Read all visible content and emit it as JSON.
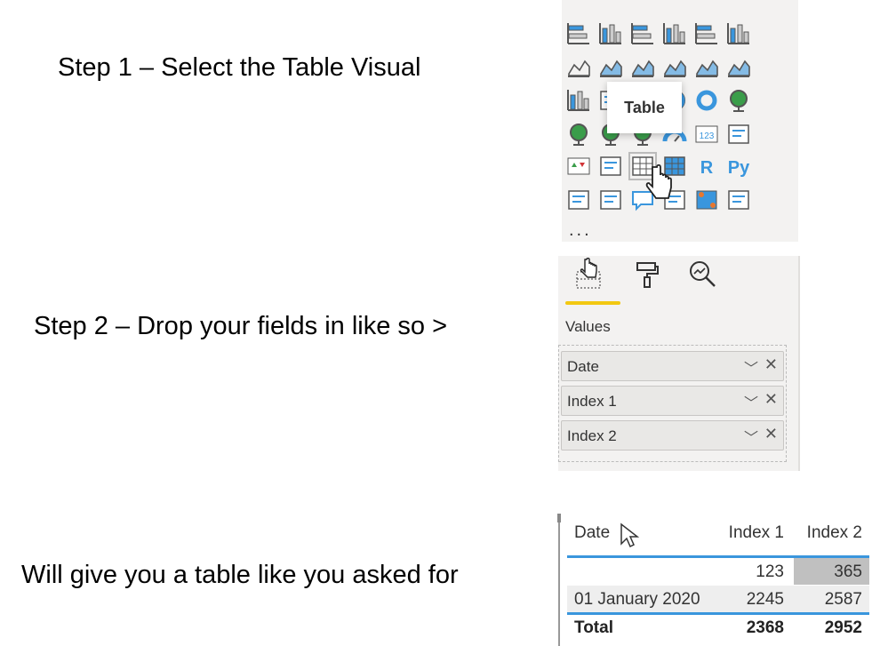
{
  "steps": {
    "step1": "Step 1 – Select the Table Visual",
    "step2": "Step 2 – Drop your fields in like so >",
    "step3": "Will give you a table like you asked for"
  },
  "colors": {
    "accent_blue": "#3a96dd",
    "highlight_yellow": "#f2c811",
    "panel_bg": "#f3f2f1",
    "selected_cell": "#c0c0c0"
  },
  "visualizations": {
    "tooltip": "Table",
    "more": "...",
    "icons": [
      [
        "stacked-bar-icon",
        "stacked-column-icon",
        "clustered-bar-icon",
        "clustered-column-icon",
        "100-stacked-bar-icon",
        "100-stacked-column-icon"
      ],
      [
        "line-chart-icon",
        "area-chart-icon",
        "stacked-area-icon",
        "line-clustered-column-icon",
        "line-stacked-column-icon",
        "ribbon-chart-icon"
      ],
      [
        "waterfall-icon",
        "funnel-icon",
        "scatter-icon",
        "pie-chart-icon",
        "donut-chart-icon",
        "treemap-icon"
      ],
      [
        "map-icon",
        "filled-map-icon",
        "shape-map-icon",
        "gauge-icon",
        "card-icon",
        "multi-row-card-icon"
      ],
      [
        "kpi-icon",
        "slicer-icon",
        "table-icon",
        "matrix-icon",
        "r-visual-icon",
        "python-visual-icon"
      ],
      [
        "key-influencers-icon",
        "decomposition-tree-icon",
        "qa-icon",
        "smart-narrative-icon",
        "arcgis-map-icon",
        "power-apps-icon"
      ]
    ],
    "text_icons": {
      "card": "123",
      "r": "R",
      "py": "Py"
    }
  },
  "fields_pane": {
    "section_label": "Values",
    "fields": [
      {
        "label": "Date"
      },
      {
        "label": "Index 1"
      },
      {
        "label": "Index 2"
      }
    ],
    "chevron": "﹀",
    "remove": "✕"
  },
  "table": {
    "columns": [
      "Date",
      "Index 1",
      "Index 2"
    ],
    "rows": [
      [
        "",
        "123",
        "365"
      ],
      [
        "01 January 2020",
        "2245",
        "2587"
      ]
    ],
    "total": [
      "Total",
      "2368",
      "2952"
    ]
  }
}
